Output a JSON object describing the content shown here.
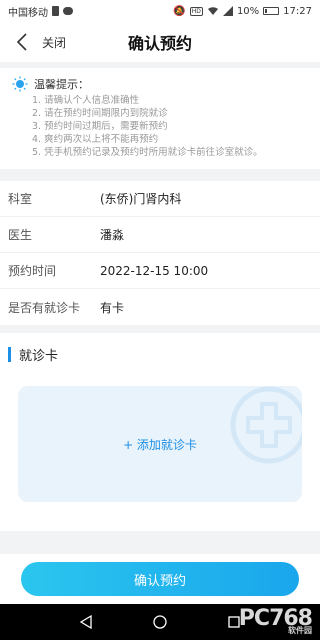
{
  "status_bar": {
    "carrier": "中国移动",
    "battery": "10%",
    "time": "17:27",
    "hd": "HD"
  },
  "nav": {
    "close_label": "关闭",
    "title": "确认预约"
  },
  "tips": {
    "title": "温馨提示：",
    "items": [
      "1. 请确认个人信息准确性",
      "2. 请在预约时间期限内到院就诊",
      "3. 预约时间过期后，需要新预约",
      "4. 爽约两次以上将不能再预约",
      "5. 凭手机预约记录及预约时所用就诊卡前往诊室就诊。"
    ]
  },
  "info": {
    "rows": [
      {
        "label": "科室",
        "value": "(东侨)门肾内科"
      },
      {
        "label": "医生",
        "value": "潘淼"
      },
      {
        "label": "预约时间",
        "value": "2022-12-15 10:00"
      },
      {
        "label": "是否有就诊卡",
        "value": "有卡"
      }
    ]
  },
  "card_section": {
    "title": "就诊卡",
    "add_label": "+ 添加就诊卡"
  },
  "confirm_button": "确认预约",
  "watermark": {
    "brand": "PC768",
    "sub": "软件园"
  },
  "colors": {
    "accent": "#1e8fe6",
    "button_gradient_start": "#2bc6ef",
    "button_gradient_end": "#1aa6ec",
    "card_bg": "#e8f3fc"
  }
}
